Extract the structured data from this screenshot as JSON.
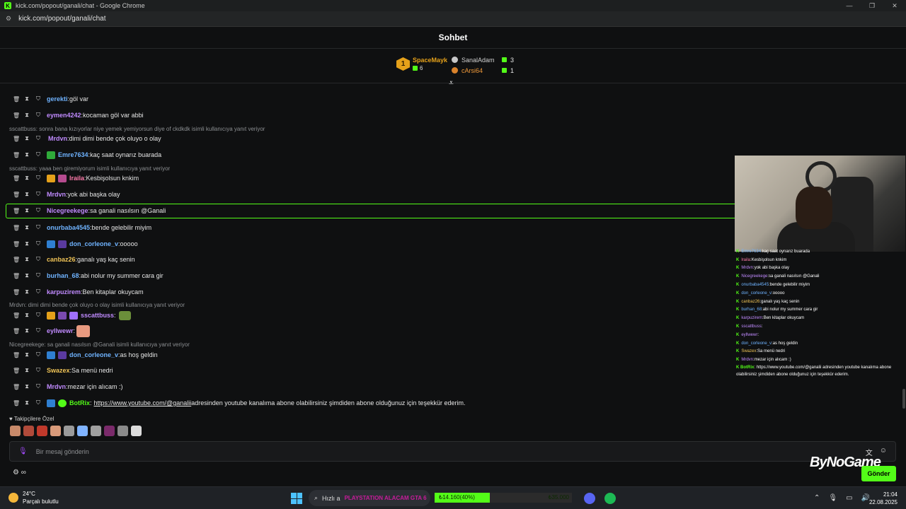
{
  "browser": {
    "title": "kick.com/popout/ganali/chat - Google Chrome",
    "url": "kick.com/popout/ganali/chat"
  },
  "chat": {
    "title": "Sohbet",
    "leaderboard": {
      "first": {
        "rank": "1",
        "name": "SpaceMayk",
        "count": "6"
      },
      "others": [
        {
          "name": "SanalAdam",
          "count": "3",
          "color": "#d0d0d0"
        },
        {
          "name": "cArsi64",
          "count": "1",
          "color": "#f09a3a"
        }
      ]
    },
    "messages": [
      {
        "user": "gerekti",
        "color": "#6fb3ff",
        "text": " göl var"
      },
      {
        "user": "eymen4242",
        "color": "#c18bff",
        "text": " kocaman göl var abbi"
      },
      {
        "user": "Mrdvn",
        "color": "#c18bff",
        "text": " dimi dimi bende çok oluyo o olay"
      },
      {
        "user": "Emre7634",
        "color": "#6fb3ff",
        "text": " kaç saat oynarız buarada"
      },
      {
        "user": "lraila",
        "color": "#ff7bab",
        "text": " Kesbişolsun knkim"
      },
      {
        "user": "Mrdvn",
        "color": "#c18bff",
        "text": " yok abi başka olay"
      },
      {
        "user": "Nicegreekege",
        "color": "#c18bff",
        "text": " sa ganali nasılsın @Ganali"
      },
      {
        "user": "onurbaba4545",
        "color": "#6fb3ff",
        "text": " bende gelebilir miyim"
      },
      {
        "user": "don_corleone_v",
        "color": "#6fb3ff",
        "text": " ooooo"
      },
      {
        "user": "canbaz26",
        "color": "#f0c457",
        "text": " ganalı yaş kaç senin"
      },
      {
        "user": "burhan_68",
        "color": "#6fb3ff",
        "text": " abi nolur my summer cara gir"
      },
      {
        "user": "karpuzirem",
        "color": "#c18bff",
        "text": " Ben kitaplar okuycam"
      },
      {
        "user": "sscattbuss",
        "color": "#c18bff",
        "text": ""
      },
      {
        "user": "eyllwewr",
        "color": "#c18bff",
        "text": ""
      },
      {
        "user": "don_corleone_v",
        "color": "#6fb3ff",
        "text": " as hoş geldin"
      },
      {
        "user": "Swazex",
        "color": "#f0c457",
        "text": " Sa menü nedri"
      },
      {
        "user": "Mrdvn",
        "color": "#c18bff",
        "text": " mezar için alıcam :)"
      },
      {
        "user": "BotRix",
        "color": "#53fc18",
        "link": "https://www.youtube.com/@ganalii",
        "text": " adresinden youtube kanalıma abone olabilirsiniz şimdiden abone olduğunuz için teşekkür ederim."
      }
    ],
    "colon": ":",
    "replies": [
      "sscattbuss: sonra bana kızıyorlar niye yemek yemiyorsun diye of ckdkdk isimli kullanıcıya yanıt veriyor",
      "sscattbuss: yaaa ben giremiyorum isimli kullanıcıya yanıt veriyor",
      "Mrdvn: dimi dimi bende çok oluyo o olay isimli kullanıcıya yanıt veriyor",
      "Nicegreekege: sa ganali nasılsın @Ganali isimli kullanıcıya yanıt veriyor"
    ],
    "followers_label": "Takipçilere Özel",
    "input_placeholder": "Bir mesaj gönderin",
    "send_label": "Gönder",
    "infinity": "∞"
  },
  "overlay": {
    "brand": "ByNoGame",
    "lines": [
      {
        "user": "Emre7634",
        "color": "#6fb3ff",
        "text": " kaç saat oynarız buarada"
      },
      {
        "user": "lraila",
        "color": "#ff7bab",
        "text": " Kesbişolsun knkim"
      },
      {
        "user": "Mrdvn",
        "color": "#c18bff",
        "text": " yok abi başka olay"
      },
      {
        "user": "Nicegreekege",
        "color": "#c18bff",
        "text": " sa ganali nasılsın @Ganali"
      },
      {
        "user": "onurbaba4545",
        "color": "#6fb3ff",
        "text": " bende gelebilir miyim"
      },
      {
        "user": "don_corleone_v",
        "color": "#6fb3ff",
        "text": " ooooo"
      },
      {
        "user": "canbaz26",
        "color": "#f0c457",
        "text": " ganalı yaş kaç senin"
      },
      {
        "user": "burhan_68",
        "color": "#6fb3ff",
        "text": " abi nolur my summer cara gir"
      },
      {
        "user": "karpuzirem",
        "color": "#c18bff",
        "text": " Ben kitaplar okuycam"
      },
      {
        "user": "sscattbuss",
        "color": "#c18bff",
        "text": ""
      },
      {
        "user": "eyllwewr",
        "color": "#c18bff",
        "text": ""
      },
      {
        "user": "don_corleone_v",
        "color": "#6fb3ff",
        "text": " as hoş geldin"
      },
      {
        "user": "Swazex",
        "color": "#f0c457",
        "text": " Sa menü nedri"
      },
      {
        "user": "Mrdvn",
        "color": "#c18bff",
        "text": " mezar için alıcam :)"
      }
    ],
    "botrix_user": "BotRix",
    "botrix_text": " https://www.youtube.com/@ganalii adresinden youtube kanalıma abone olabilirsiniz şimdiden abone olduğunuz için teşekkür ederim."
  },
  "taskbar": {
    "temperature": "24°C",
    "weather": "Parçalı bulutlu",
    "search_text": "Hızlı a",
    "promo_text": "PLAYSTATION ALACAM GTA 6",
    "donation_progress_label": "₺14.160(40%)",
    "donation_progress": 0.4,
    "donation_goal": "₺35.000",
    "time": "21:04",
    "date": "22.08.2025"
  }
}
